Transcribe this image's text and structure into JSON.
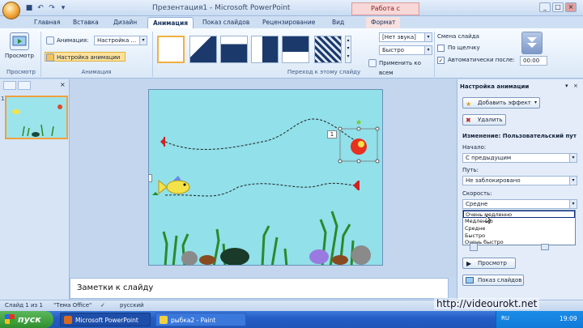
{
  "title_bar": {
    "title": "Презентация1 - Microsoft PowerPoint",
    "context_label": "Работа с рисунками",
    "minimize": "_",
    "maximize": "□",
    "close": "×"
  },
  "tabs": [
    "Главная",
    "Вставка",
    "Дизайн",
    "Анимация",
    "Показ слайдов",
    "Рецензирование",
    "Вид",
    "Формат"
  ],
  "active_tab": "Анимация",
  "ribbon": {
    "preview_label": "Просмотр",
    "preview_group_label": "Просмотр",
    "animation_label": "Анимация:",
    "animation_value": "Настройка ...",
    "custom_animation_button": "Настройка анимации",
    "animation_group_label": "Анимация",
    "transition_group_label": "Переход к этому слайду",
    "sound_value": "[Нет звука]",
    "speed_value": "Быстро",
    "apply_all": "Применить ко всем",
    "advance_title": "Смена слайда",
    "on_click": "По щелчку",
    "auto_after": "Автоматически после:",
    "time_value": "00:00"
  },
  "left_pane": {
    "slide_number": "1"
  },
  "slide": {
    "marker_1": "1",
    "marker_2": "1"
  },
  "notes": {
    "placeholder": "Заметки к слайду"
  },
  "task_pane": {
    "title": "Настройка анимации",
    "add_effect": "Добавить эффект",
    "remove": "Удалить",
    "change_label": "Изменение: Пользовательский пут",
    "start_label": "Начало:",
    "start_value": "С предыдущим",
    "path_label": "Путь:",
    "path_value": "Не заблокировано",
    "speed_label": "Скорость:",
    "speed_value": "Средне",
    "speed_options": [
      "Очень медленно",
      "Медленно",
      "Средне",
      "Быстро",
      "Очень быстро"
    ],
    "preview_button": "Просмотр",
    "slideshow_button": "Показ слайдов"
  },
  "status_bar": {
    "slide_info": "Слайд 1 из 1",
    "theme": "\"Тема Office\"",
    "language": "русский"
  },
  "taskbar": {
    "start": "пуск",
    "tasks": [
      "Microsoft PowerPoint",
      "рыбка2 - Paint"
    ],
    "lang": "RU",
    "clock": "19:09"
  },
  "watermark": "http://videourokt.net",
  "colors": {
    "accent": "#f0a040",
    "slide_bg": "#91e0ea",
    "taskbar": "#245ec7",
    "start": "#2f8f2f"
  }
}
